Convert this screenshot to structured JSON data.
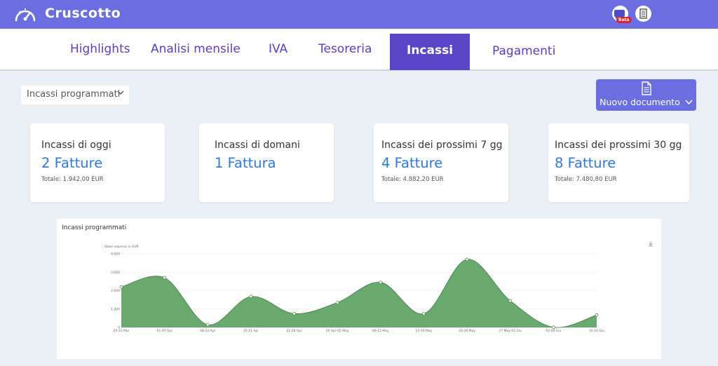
{
  "header": {
    "title": "Cruscotto",
    "beta_badge": "Beta"
  },
  "tabs": [
    {
      "label": "Highlights"
    },
    {
      "label": "Analisi mensile"
    },
    {
      "label": "IVA"
    },
    {
      "label": "Tesoreria"
    },
    {
      "label": "Incassi",
      "active": true
    },
    {
      "label": "Pagamenti"
    }
  ],
  "filter": {
    "selected": "Incassi programmati"
  },
  "new_document_button": {
    "label": "Nuovo documento"
  },
  "cards": [
    {
      "title": "Incassi di oggi",
      "value": "2 Fatture",
      "total": "Totale: 1.942,00 EUR"
    },
    {
      "title": "Incassi di domani",
      "value": "1 Fattura",
      "total": ""
    },
    {
      "title": "Incassi dei prossimi 7 gg",
      "value": "4 Fatture",
      "total": "Totale: 4.882,20 EUR"
    },
    {
      "title": "Incassi dei prossimi 30 gg",
      "value": "8 Fatture",
      "total": "Totale: 7.480,80 EUR"
    }
  ],
  "chart_panel": {
    "title": "Incassi programmati"
  },
  "icons": {
    "brand": "speedometer-icon",
    "chat": "chat-icon",
    "document": "document-icon",
    "new_document": "file-text-icon",
    "download": "download-icon",
    "chevron": "chevron-down-icon"
  },
  "colors": {
    "brand": "#6a6ee0",
    "active_tab": "#5a45c6",
    "tab_text": "#5b3cc4",
    "value_text": "#2f78e0",
    "chart_fill": "#5aa05e"
  },
  "chart_data": {
    "type": "area",
    "subtitle": "Valori espressi in EUR",
    "categories": [
      "29-31 Mar",
      "01-07 Apr",
      "08-14 Apr",
      "15-21 Apr",
      "22-28 Apr",
      "29 Apr-05 May",
      "06-12 May",
      "13-19 May",
      "20-26 May",
      "27 May-02 Giu",
      "03-09 Giu",
      "10-16 Giu"
    ],
    "series": [
      {
        "values": [
          2200,
          2700,
          150,
          1680,
          750,
          1350,
          2450,
          750,
          3700,
          1450,
          10,
          680
        ]
      }
    ],
    "yticks": [
      "0",
      "1.000",
      "2.000",
      "3.000",
      "4.000"
    ],
    "ylim": [
      0,
      4000
    ],
    "grid": true,
    "legend": false
  }
}
